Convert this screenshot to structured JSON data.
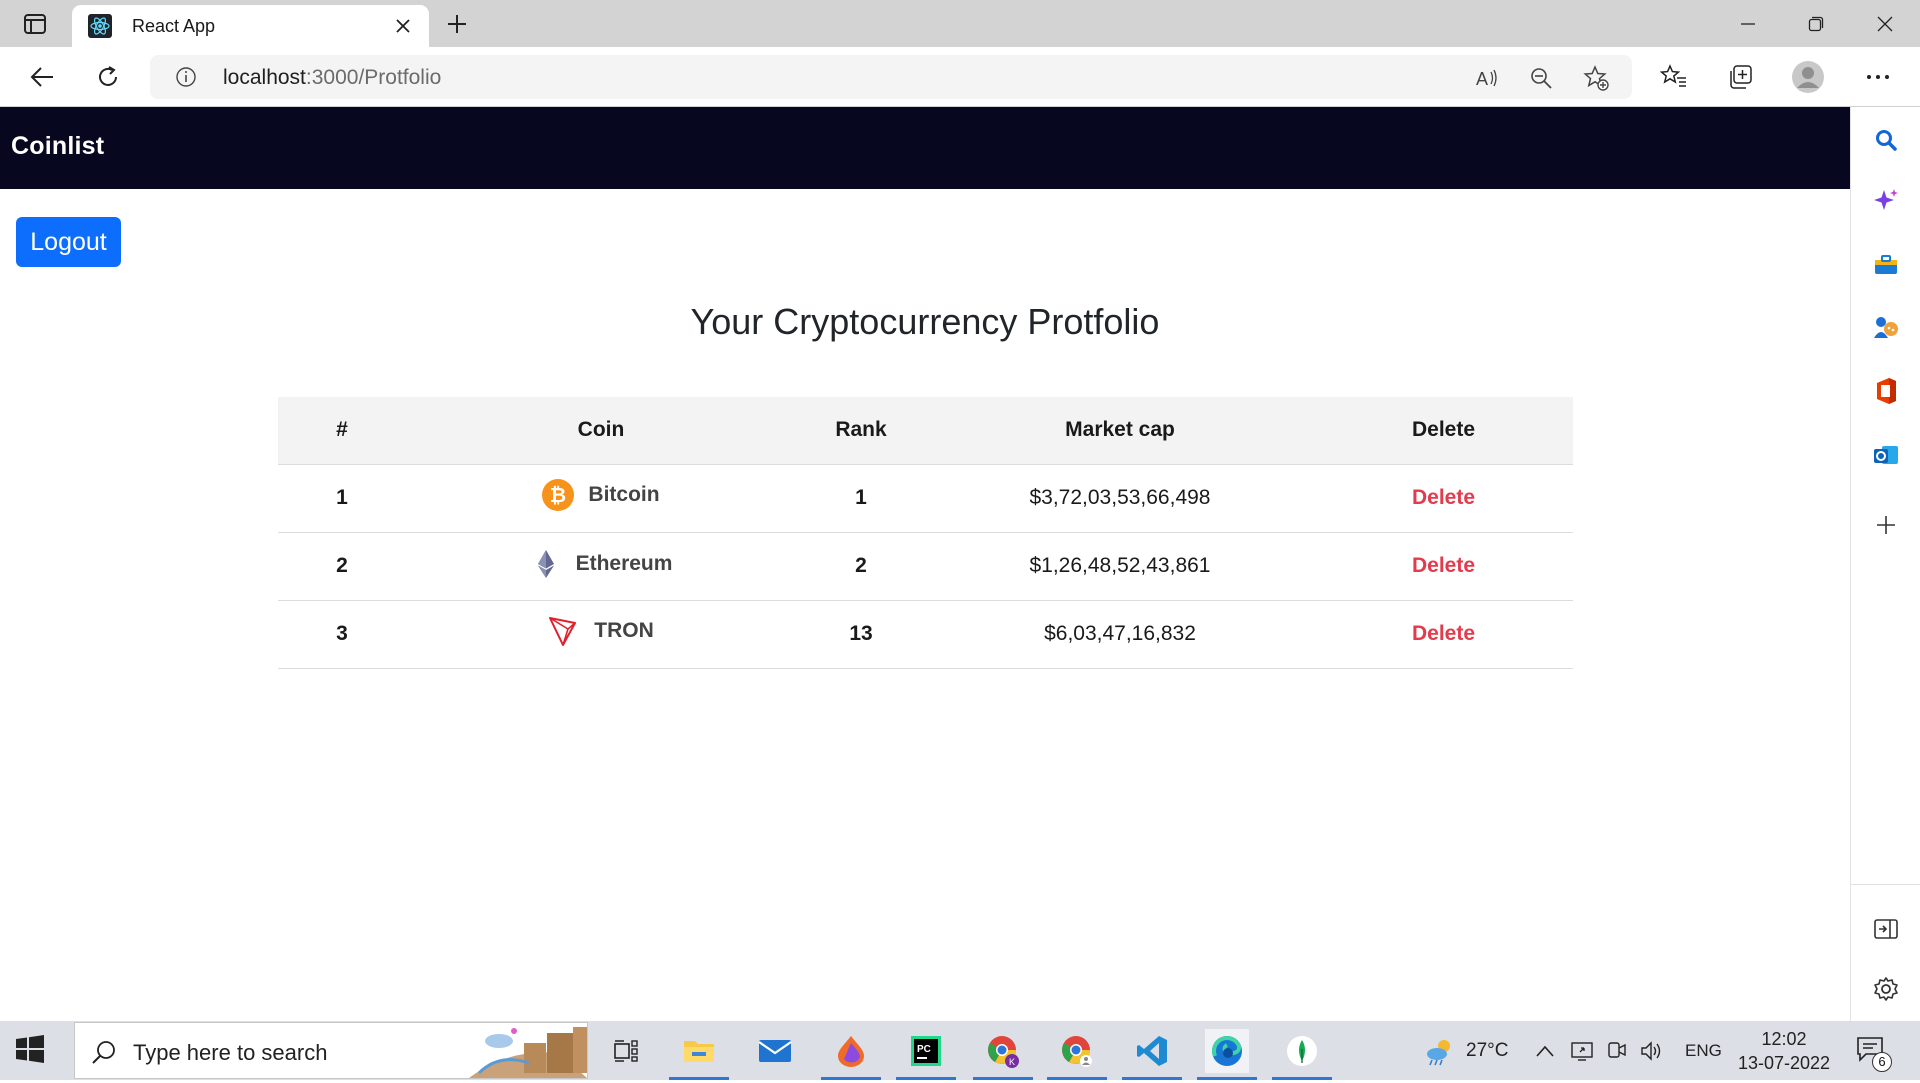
{
  "browser": {
    "tab_title": "React App",
    "url_host": "localhost",
    "url_path": ":3000/Protfolio"
  },
  "app": {
    "brand": "Coinlist",
    "logout_label": "Logout",
    "page_title": "Your Cryptocurrency Protfolio"
  },
  "table": {
    "headers": [
      "#",
      "Coin",
      "Rank",
      "Market cap",
      "Delete"
    ],
    "rows": [
      {
        "num": "1",
        "coin": "Bitcoin",
        "icon": "bitcoin-icon",
        "rank": "1",
        "market_cap": "$3,72,03,53,66,498",
        "delete": "Delete"
      },
      {
        "num": "2",
        "coin": "Ethereum",
        "icon": "ethereum-icon",
        "rank": "2",
        "market_cap": "$1,26,48,52,43,861",
        "delete": "Delete"
      },
      {
        "num": "3",
        "coin": "TRON",
        "icon": "tron-icon",
        "rank": "13",
        "market_cap": "$6,03,47,16,832",
        "delete": "Delete"
      }
    ]
  },
  "taskbar": {
    "search_placeholder": "Type here to search",
    "weather": "27°C",
    "language": "ENG",
    "time": "12:02",
    "date": "13-07-2022",
    "notification_count": "6"
  },
  "colors": {
    "navbar": "#070720",
    "primary_button": "#0d6efd",
    "delete": "#e33b4e",
    "bitcoin": "#f7931a",
    "tron": "#e0212e",
    "ethereum": "#62688f"
  }
}
